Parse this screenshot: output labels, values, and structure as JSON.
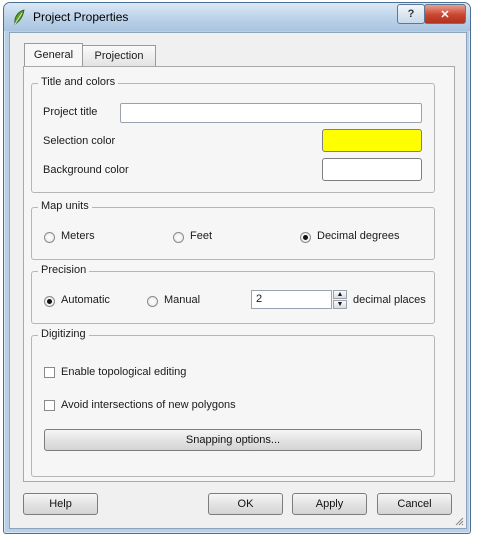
{
  "window": {
    "title": "Project Properties",
    "help_glyph": "?",
    "close_glyph": "✕"
  },
  "tabs": [
    {
      "label": "General",
      "active": true
    },
    {
      "label": "Projection",
      "active": false
    }
  ],
  "title_colors": {
    "group_title": "Title and colors",
    "project_title_label": "Project title",
    "project_title_value": "",
    "selection_color_label": "Selection color",
    "selection_color": "#ffff00",
    "background_color_label": "Background color",
    "background_color": "#ffffff"
  },
  "map_units": {
    "group_title": "Map units",
    "options": [
      "Meters",
      "Feet",
      "Decimal degrees"
    ],
    "selected": "Decimal degrees"
  },
  "precision": {
    "group_title": "Precision",
    "options": [
      "Automatic",
      "Manual"
    ],
    "selected": "Automatic",
    "decimal_places_value": "2",
    "decimal_places_label": "decimal places"
  },
  "digitizing": {
    "group_title": "Digitizing",
    "topological_label": "Enable topological editing",
    "topological_checked": false,
    "avoid_intersections_label": "Avoid intersections of new polygons",
    "avoid_intersections_checked": false,
    "snapping_button": "Snapping options..."
  },
  "buttons": {
    "help": "Help",
    "ok": "OK",
    "apply": "Apply",
    "cancel": "Cancel"
  }
}
